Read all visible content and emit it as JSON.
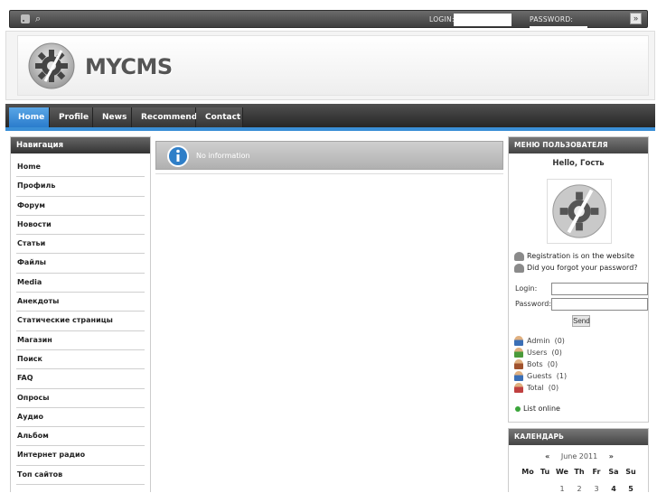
{
  "topbar": {
    "rss_icon": "rss-icon",
    "search_icon": "search-icon",
    "login_label": "LOGIN:",
    "password_label": "PASSWORD:",
    "go_glyph": "»"
  },
  "header": {
    "logo_text": "MYCMS",
    "logo_icon": "gear-icon"
  },
  "nav": {
    "tabs": [
      {
        "label": "Home",
        "active": true
      },
      {
        "label": "Profile"
      },
      {
        "label": "News"
      },
      {
        "label": "Recommend"
      },
      {
        "label": "Contact"
      }
    ]
  },
  "left": {
    "title": "Навигация",
    "items": [
      "Home",
      "Профиль",
      "Форум",
      "Новости",
      "Статьи",
      "Файлы",
      "Media",
      "Анекдоты",
      "Статические страницы",
      "Магазин",
      "Поиск",
      "FAQ",
      "Опросы",
      "Аудио",
      "Альбом",
      "Интернет радио",
      "Топ сайтов"
    ]
  },
  "center": {
    "info_text": "No information",
    "info_icon": "info-icon"
  },
  "user_menu": {
    "title": "Меню пользователя",
    "hello": "Hello, Гость",
    "register_link": "Registration is on the website",
    "forgot_link": "Did you forgot your password?",
    "login_label": "Login:",
    "password_label": "Password:",
    "send_label": "Send",
    "stats": [
      {
        "label": "Admin",
        "count": "(0)",
        "color": "#3b6fb6"
      },
      {
        "label": "Users",
        "count": "(0)",
        "color": "#4a9a3a"
      },
      {
        "label": "Bots",
        "count": "(0)",
        "color": "#a0522d"
      },
      {
        "label": "Guests",
        "count": "(1)",
        "color": "#3b6fb6"
      },
      {
        "label": "Total",
        "count": "(0)",
        "color": "#c04040"
      }
    ],
    "list_online": "List online"
  },
  "calendar": {
    "title": "Календарь",
    "prev": "«",
    "next": "»",
    "month": "June 2011",
    "days": [
      "Mo",
      "Tu",
      "We",
      "Th",
      "Fr",
      "Sa",
      "Su"
    ],
    "first_row": [
      "",
      "",
      "1",
      "2",
      "3",
      "4",
      "5"
    ]
  },
  "colors": {
    "accent": "#3a8fd6",
    "nav_dark": "#333333"
  }
}
